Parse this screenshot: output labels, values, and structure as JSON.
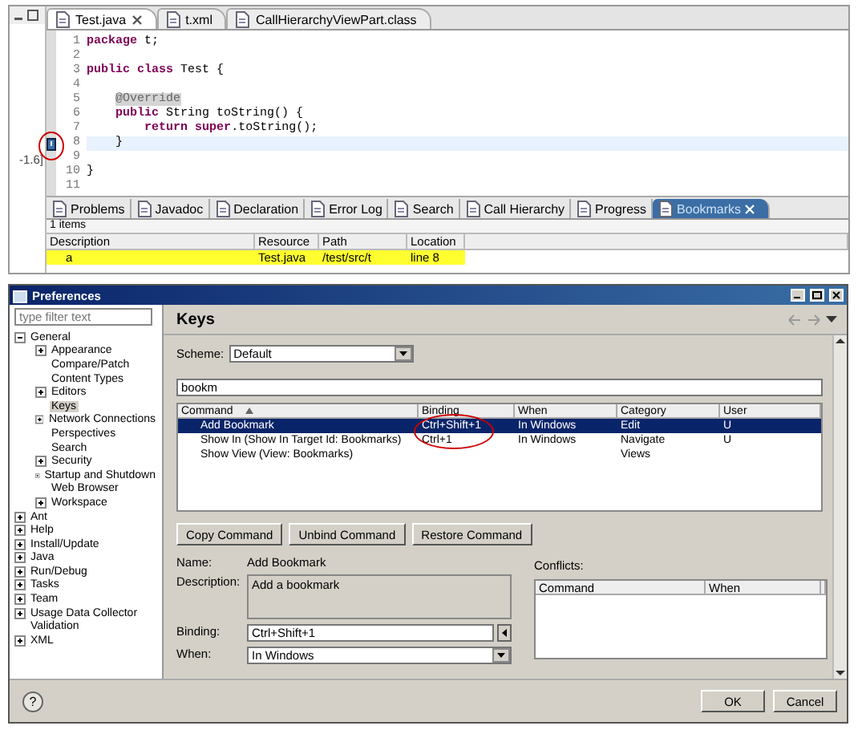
{
  "side_panel": {
    "label": "-1.6]"
  },
  "editor": {
    "tabs": [
      {
        "label": "Test.java",
        "selected": true,
        "closable": true
      },
      {
        "label": "t.xml",
        "selected": false,
        "closable": false
      },
      {
        "label": "CallHierarchyViewPart.class",
        "selected": false,
        "closable": false
      }
    ],
    "lines": [
      {
        "number": "1",
        "kind": "code",
        "code": "**package** t;",
        "current": false,
        "bookmarked": false
      },
      {
        "number": "2",
        "kind": "code",
        "current": false,
        "bookmarked": false
      },
      {
        "number": "3",
        "kind": "code",
        "code": "**public** **class** Test {",
        "current": false,
        "bookmarked": false
      },
      {
        "number": "4",
        "kind": "code",
        "current": false,
        "bookmarked": false
      },
      {
        "number": "5",
        "kind": "annotation",
        "code": "@Override",
        "current": false,
        "bookmarked": false
      },
      {
        "number": "6",
        "kind": "code",
        "code": "**public** String toString() {",
        "current": false,
        "bookmarked": false
      },
      {
        "number": "7",
        "kind": "code",
        "code": "**return** **super**.toString();",
        "current": false,
        "bookmarked": false
      },
      {
        "number": "8",
        "kind": "code",
        "code": "}",
        "current": true,
        "bookmarked": true
      },
      {
        "number": "9",
        "kind": "code",
        "current": false,
        "bookmarked": false
      },
      {
        "number": "10",
        "kind": "code",
        "code": "}",
        "current": false,
        "bookmarked": false
      },
      {
        "number": "11",
        "kind": "code",
        "current": false,
        "bookmarked": false
      }
    ]
  },
  "views": {
    "tabs": [
      {
        "label": "Problems",
        "selected": false
      },
      {
        "label": "Javadoc",
        "selected": false
      },
      {
        "label": "Declaration",
        "selected": false
      },
      {
        "label": "Error Log",
        "selected": false
      },
      {
        "label": "Search",
        "selected": false
      },
      {
        "label": "Call Hierarchy",
        "selected": false
      },
      {
        "label": "Progress",
        "selected": false
      },
      {
        "label": "Bookmarks",
        "selected": true
      }
    ],
    "summary": "1 items",
    "columns": [
      "Description",
      "Resource",
      "Path",
      "Location"
    ],
    "rows": [
      {
        "cells": [
          "a",
          "Test.java",
          "/test/src/t",
          "line 8"
        ],
        "highlighted": true
      }
    ]
  },
  "preferences": {
    "title": "Preferences",
    "filter": {
      "placeholder": "type filter text"
    },
    "tree": [
      {
        "label": "General",
        "expanded": true,
        "selected": false,
        "children": [
          {
            "label": "Appearance",
            "expanded": false,
            "selected": false
          },
          {
            "label": "Compare/Patch",
            "selected": false
          },
          {
            "label": "Content Types",
            "selected": false
          },
          {
            "label": "Editors",
            "expanded": false,
            "selected": false
          },
          {
            "label": "Keys",
            "selected": true
          },
          {
            "label": "Network Connections",
            "expanded": false,
            "selected": false
          },
          {
            "label": "Perspectives",
            "selected": false
          },
          {
            "label": "Search",
            "selected": false
          },
          {
            "label": "Security",
            "expanded": false,
            "selected": false
          },
          {
            "label": "Startup and Shutdown",
            "expanded": false,
            "selected": false
          },
          {
            "label": "Web Browser",
            "selected": false
          },
          {
            "label": "Workspace",
            "expanded": false,
            "selected": false
          }
        ]
      },
      {
        "label": "Ant",
        "expanded": false,
        "selected": false
      },
      {
        "label": "Help",
        "expanded": false,
        "selected": false
      },
      {
        "label": "Install/Update",
        "expanded": false,
        "selected": false
      },
      {
        "label": "Java",
        "expanded": false,
        "selected": false
      },
      {
        "label": "Run/Debug",
        "expanded": false,
        "selected": false
      },
      {
        "label": "Tasks",
        "expanded": false,
        "selected": false
      },
      {
        "label": "Team",
        "expanded": false,
        "selected": false
      },
      {
        "label": "Usage Data Collector",
        "expanded": false,
        "selected": false
      },
      {
        "label": "Validation",
        "selected": false
      },
      {
        "label": "XML",
        "expanded": false,
        "selected": false
      }
    ],
    "page_title": "Keys",
    "scheme": {
      "label": "Scheme:",
      "value": "Default"
    },
    "search": {
      "value": "bookm"
    },
    "commands": {
      "columns": [
        "Command",
        "Binding",
        "When",
        "Category",
        "User"
      ],
      "rows": [
        {
          "cells": [
            "Add Bookmark",
            "Ctrl+Shift+1",
            "In Windows",
            "Edit",
            "U"
          ],
          "selected": true
        },
        {
          "cells": [
            "Show In (Show In Target Id: Bookmarks)",
            "Ctrl+1",
            "In Windows",
            "Navigate",
            "U"
          ],
          "selected": false
        },
        {
          "cells": [
            "Show View (View: Bookmarks)",
            "",
            "",
            "Views",
            ""
          ],
          "selected": false
        }
      ]
    },
    "command_buttons": [
      "Copy Command",
      "Unbind Command",
      "Restore Command"
    ],
    "name": {
      "label": "Name:",
      "value": "Add Bookmark"
    },
    "description": {
      "label": "Description:",
      "value": "Add a bookmark"
    },
    "binding": {
      "label": "Binding:",
      "value": "Ctrl+Shift+1"
    },
    "when": {
      "label": "When:",
      "value": "In Windows"
    },
    "conflicts": {
      "label": "Conflicts:",
      "columns": [
        "Command",
        "When"
      ]
    },
    "help": "?",
    "buttons": [
      "OK",
      "Cancel"
    ]
  }
}
